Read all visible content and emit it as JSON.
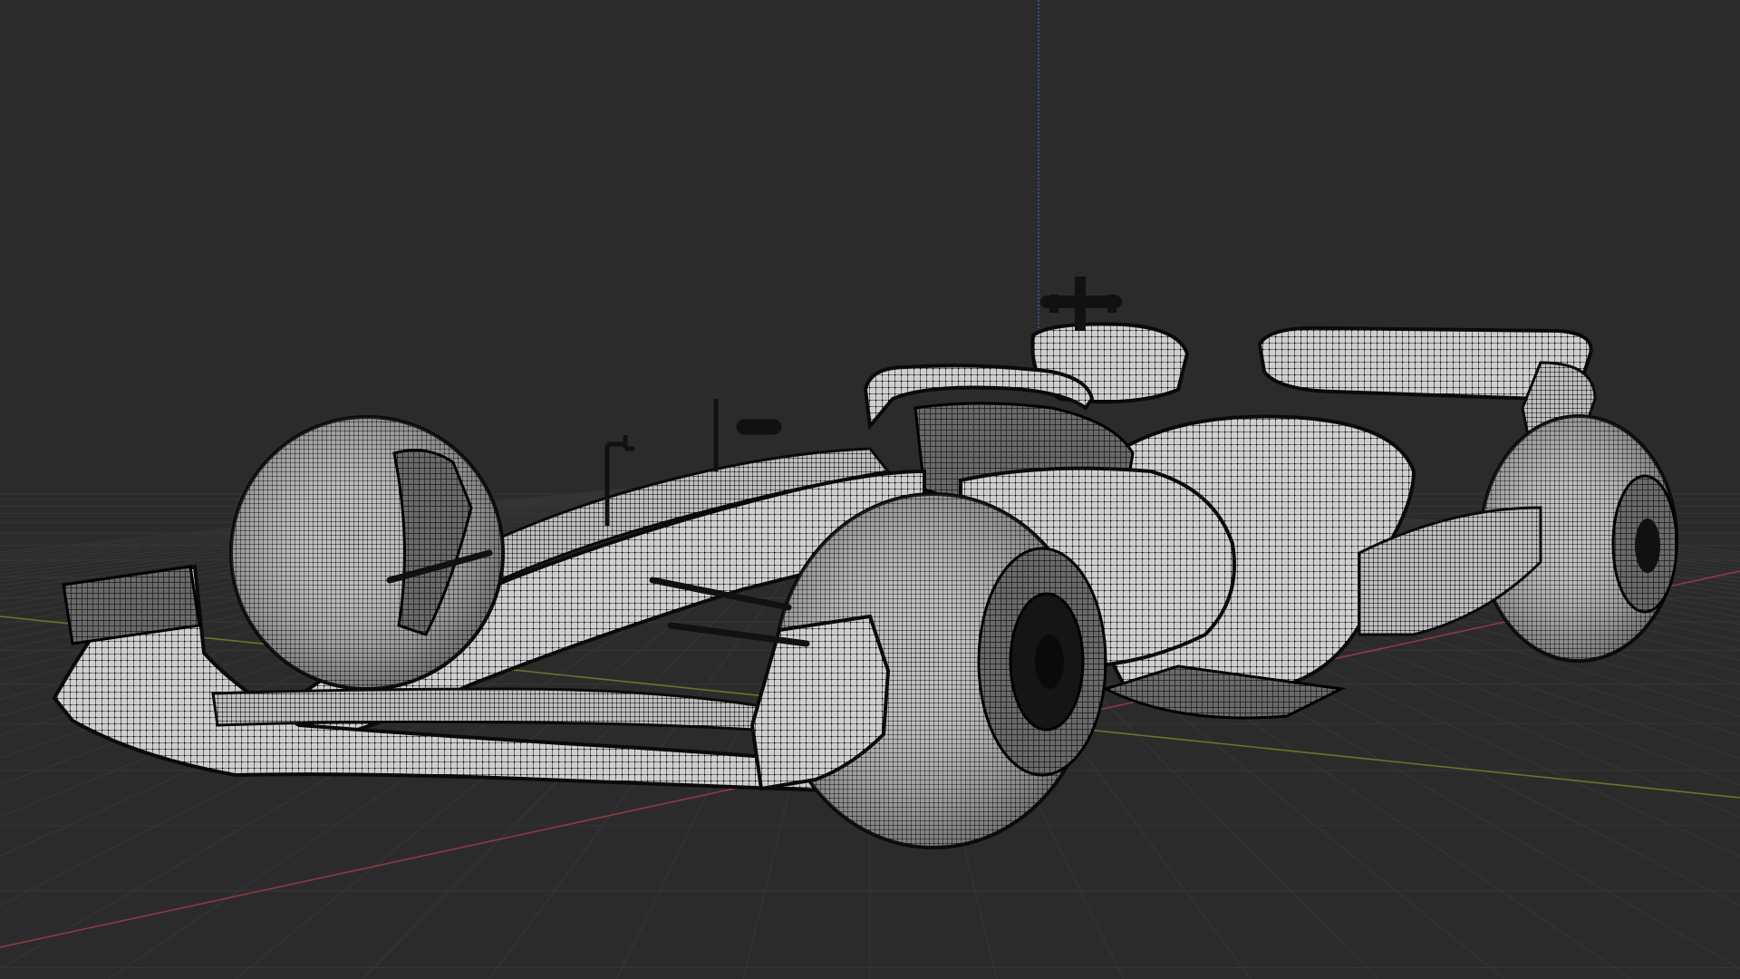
{
  "viewport": {
    "background": "#2b2b2b",
    "grid_color": "#333333",
    "axis_x_color": "#8f3a44",
    "axis_y_color": "#5f7a2c",
    "axis_z_color": "#3d5f9a",
    "mesh_fill": "#cfcfcf",
    "mesh_wire": "#111111",
    "object": "race-car-mesh",
    "display_mode": "wireframe-overlay"
  }
}
